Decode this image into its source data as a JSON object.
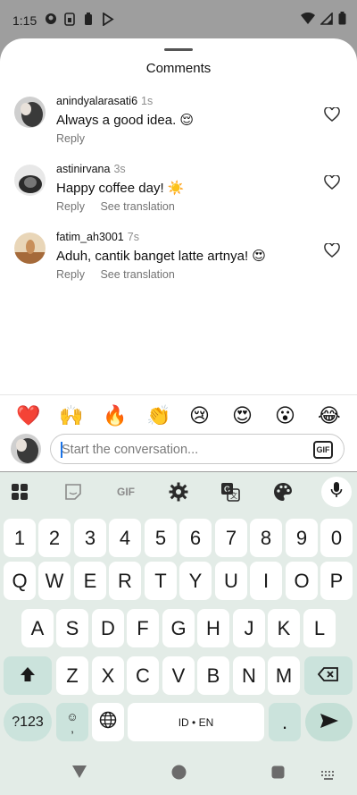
{
  "status_bar": {
    "time": "1:15"
  },
  "sheet": {
    "title": "Comments"
  },
  "comments": [
    {
      "username": "anindyalarasati6",
      "time": "1s",
      "text": "Always a good idea. 😌",
      "reply": "Reply",
      "translate": ""
    },
    {
      "username": "astinirvana",
      "time": "3s",
      "text": "Happy coffee day! ☀️",
      "reply": "Reply",
      "translate": "See translation"
    },
    {
      "username": "fatim_ah3001",
      "time": "7s",
      "text": "Aduh, cantik banget latte artnya! 😍",
      "reply": "Reply",
      "translate": "See translation"
    }
  ],
  "reactions": [
    "❤️",
    "🙌",
    "🔥",
    "👏",
    "😢",
    "😍",
    "😮",
    "😂"
  ],
  "input": {
    "placeholder": "Start the conversation...",
    "value": "",
    "gif_label": "GIF"
  },
  "keyboard": {
    "toolbar_gif": "GIF",
    "row1": [
      "1",
      "2",
      "3",
      "4",
      "5",
      "6",
      "7",
      "8",
      "9",
      "0"
    ],
    "row2": [
      "Q",
      "W",
      "E",
      "R",
      "T",
      "Y",
      "U",
      "I",
      "O",
      "P"
    ],
    "row3": [
      "A",
      "S",
      "D",
      "F",
      "G",
      "H",
      "J",
      "K",
      "L"
    ],
    "row4": [
      "Z",
      "X",
      "C",
      "V",
      "B",
      "N",
      "M"
    ],
    "symbols": "?123",
    "comma": ",",
    "space": "ID • EN",
    "period": "."
  },
  "colors": {
    "keyboard_bg": "#e3ece7",
    "special_key": "#cbe3dc",
    "status_bg": "#9e9e9e"
  }
}
